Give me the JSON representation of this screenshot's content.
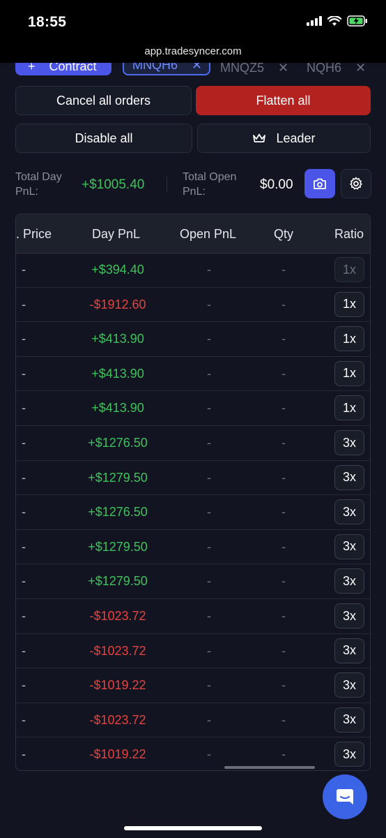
{
  "status_bar": {
    "time": "18:55",
    "url": "app.tradesyncer.com"
  },
  "toolbar": {
    "contract_label": "Contract",
    "chips": [
      {
        "label": "MNQH6",
        "active": true
      },
      {
        "label": "MNQZ5",
        "active": false
      },
      {
        "label": "NQH6",
        "active": false
      }
    ]
  },
  "actions": {
    "cancel_all": "Cancel all orders",
    "flatten_all": "Flatten all",
    "disable_all": "Disable all",
    "leader": "Leader"
  },
  "summary": {
    "total_day_pnl_label": "Total Day PnL:",
    "total_day_pnl_value": "+$1005.40",
    "total_open_pnl_label": "Total Open PnL:",
    "total_open_pnl_value": "$0.00"
  },
  "table": {
    "columns": [
      ". Price",
      "Day PnL",
      "Open PnL",
      "Qty",
      "Ratio"
    ],
    "rows": [
      {
        "price": "-",
        "day_pnl": "+$394.40",
        "open_pnl": "-",
        "qty": "-",
        "ratio": "1x",
        "sign": "pos",
        "ratio_disabled": true
      },
      {
        "price": "-",
        "day_pnl": "-$1912.60",
        "open_pnl": "-",
        "qty": "-",
        "ratio": "1x",
        "sign": "neg"
      },
      {
        "price": "-",
        "day_pnl": "+$413.90",
        "open_pnl": "-",
        "qty": "-",
        "ratio": "1x",
        "sign": "pos"
      },
      {
        "price": "-",
        "day_pnl": "+$413.90",
        "open_pnl": "-",
        "qty": "-",
        "ratio": "1x",
        "sign": "pos"
      },
      {
        "price": "-",
        "day_pnl": "+$413.90",
        "open_pnl": "-",
        "qty": "-",
        "ratio": "1x",
        "sign": "pos"
      },
      {
        "price": "-",
        "day_pnl": "+$1276.50",
        "open_pnl": "-",
        "qty": "-",
        "ratio": "3x",
        "sign": "pos"
      },
      {
        "price": "-",
        "day_pnl": "+$1279.50",
        "open_pnl": "-",
        "qty": "-",
        "ratio": "3x",
        "sign": "pos"
      },
      {
        "price": "-",
        "day_pnl": "+$1276.50",
        "open_pnl": "-",
        "qty": "-",
        "ratio": "3x",
        "sign": "pos"
      },
      {
        "price": "-",
        "day_pnl": "+$1279.50",
        "open_pnl": "-",
        "qty": "-",
        "ratio": "3x",
        "sign": "pos"
      },
      {
        "price": "-",
        "day_pnl": "+$1279.50",
        "open_pnl": "-",
        "qty": "-",
        "ratio": "3x",
        "sign": "pos"
      },
      {
        "price": "-",
        "day_pnl": "-$1023.72",
        "open_pnl": "-",
        "qty": "-",
        "ratio": "3x",
        "sign": "neg"
      },
      {
        "price": "-",
        "day_pnl": "-$1023.72",
        "open_pnl": "-",
        "qty": "-",
        "ratio": "3x",
        "sign": "neg"
      },
      {
        "price": "-",
        "day_pnl": "-$1019.22",
        "open_pnl": "-",
        "qty": "-",
        "ratio": "3x",
        "sign": "neg"
      },
      {
        "price": "-",
        "day_pnl": "-$1023.72",
        "open_pnl": "-",
        "qty": "-",
        "ratio": "3x",
        "sign": "neg"
      },
      {
        "price": "-",
        "day_pnl": "-$1019.22",
        "open_pnl": "-",
        "qty": "-",
        "ratio": "3x",
        "sign": "neg"
      }
    ]
  },
  "colors": {
    "accent": "#4b55e8",
    "danger": "#b3221f",
    "positive": "#3ec25c",
    "negative": "#e4433f"
  },
  "icons": [
    "signal-icon",
    "wifi-icon",
    "battery-icon",
    "close-icon",
    "crown-icon",
    "camera-icon",
    "gear-icon",
    "chat-icon"
  ]
}
